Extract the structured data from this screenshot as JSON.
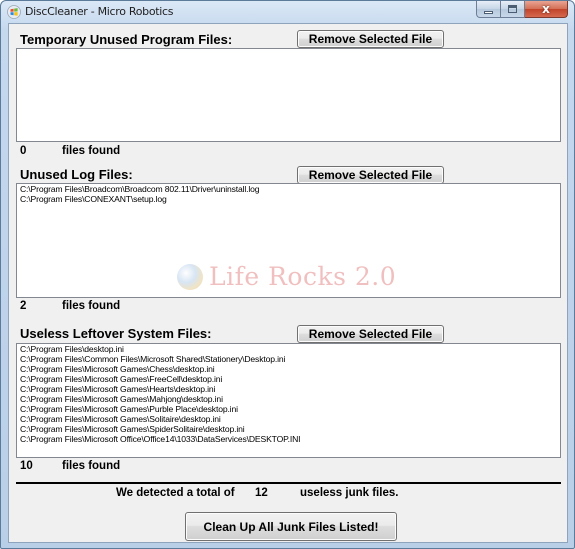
{
  "window": {
    "title": "DiscCleaner - Micro Robotics",
    "controls": {
      "minimize": "minimize",
      "maximize": "maximize",
      "close": "x"
    }
  },
  "sections": [
    {
      "label": "Temporary Unused Program Files:",
      "button_label": "Remove Selected File",
      "items": [],
      "count": "0",
      "count_label": "files found"
    },
    {
      "label": "Unused Log Files:",
      "button_label": "Remove Selected File",
      "items": [
        "C:\\Program Files\\Broadcom\\Broadcom 802.11\\Driver\\uninstall.log",
        "C:\\Program Files\\CONEXANT\\setup.log"
      ],
      "count": "2",
      "count_label": "files found"
    },
    {
      "label": "Useless Leftover System Files:",
      "button_label": "Remove Selected File",
      "items": [
        "C:\\Program Files\\desktop.ini",
        "C:\\Program Files\\Common Files\\Microsoft Shared\\Stationery\\Desktop.ini",
        "C:\\Program Files\\Microsoft Games\\Chess\\desktop.ini",
        "C:\\Program Files\\Microsoft Games\\FreeCell\\desktop.ini",
        "C:\\Program Files\\Microsoft Games\\Hearts\\desktop.ini",
        "C:\\Program Files\\Microsoft Games\\Mahjong\\desktop.ini",
        "C:\\Program Files\\Microsoft Games\\Purble Place\\desktop.ini",
        "C:\\Program Files\\Microsoft Games\\Solitaire\\desktop.ini",
        "C:\\Program Files\\Microsoft Games\\SpiderSolitaire\\desktop.ini",
        "C:\\Program Files\\Microsoft Office\\Office14\\1033\\DataServices\\DESKTOP.INI"
      ],
      "count": "10",
      "count_label": "files found"
    }
  ],
  "summary": {
    "prefix": "We detected a total of",
    "total": "12",
    "suffix": "useless junk files."
  },
  "cleanup_button_label": "Clean Up All Junk Files Listed!",
  "watermark": {
    "text": "Life Rocks 2.0",
    "icon": "globe-icon"
  }
}
